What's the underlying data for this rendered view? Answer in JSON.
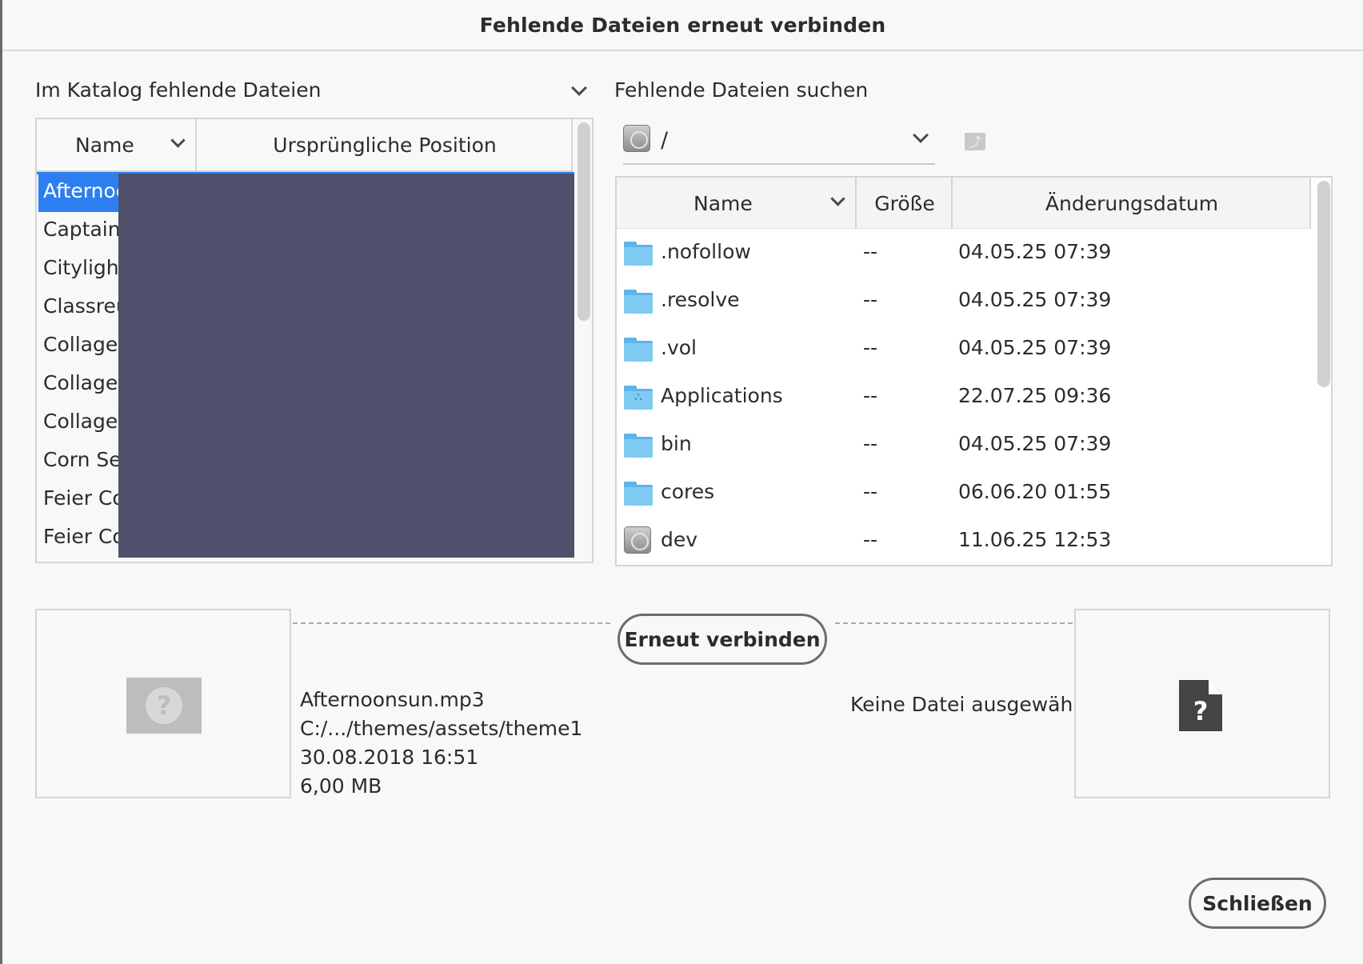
{
  "window": {
    "title": "Fehlende Dateien erneut verbinden"
  },
  "catalog": {
    "label": "Im Katalog fehlende Dateien",
    "columns": {
      "name": "Name",
      "position": "Ursprüngliche Position"
    },
    "rows": [
      {
        "name": "Afternoc"
      },
      {
        "name": "Captainz"
      },
      {
        "name": "Citylight"
      },
      {
        "name": "Classreu"
      },
      {
        "name": "Collage "
      },
      {
        "name": "Collage "
      },
      {
        "name": "Collage "
      },
      {
        "name": "Corn Sec"
      },
      {
        "name": "Feier Co"
      },
      {
        "name": "Feier Co"
      }
    ]
  },
  "search": {
    "label": "Fehlende Dateien suchen",
    "path": "/",
    "columns": {
      "name": "Name",
      "size": "Größe",
      "date": "Änderungsdatum"
    },
    "rows": [
      {
        "icon": "folder-icon",
        "name": ".nofollow",
        "size": "--",
        "date": "04.05.25 07:39"
      },
      {
        "icon": "folder-icon",
        "name": ".resolve",
        "size": "--",
        "date": "04.05.25 07:39"
      },
      {
        "icon": "folder-icon",
        "name": ".vol",
        "size": "--",
        "date": "04.05.25 07:39"
      },
      {
        "icon": "applications-folder-icon",
        "name": "Applications",
        "size": "--",
        "date": "22.07.25 09:36"
      },
      {
        "icon": "folder-icon",
        "name": "bin",
        "size": "--",
        "date": "04.05.25 07:39"
      },
      {
        "icon": "folder-icon",
        "name": "cores",
        "size": "--",
        "date": "06.06.20 01:55"
      },
      {
        "icon": "disk-icon",
        "name": "dev",
        "size": "--",
        "date": "11.06.25 12:53"
      }
    ]
  },
  "preview": {
    "file_name": "Afternoonsun.mp3",
    "file_path": "C:/.../themes/assets/theme1",
    "file_date": "30.08.2018 16:51",
    "file_size": "6,00 MB",
    "no_file_text": "Keine Datei ausgewählt"
  },
  "buttons": {
    "relink": "Erneut verbinden",
    "close": "Schließen"
  },
  "colors": {
    "selection": "#2d7ff0",
    "redaction": "#4f506b",
    "folder": "#7fcaf3"
  }
}
